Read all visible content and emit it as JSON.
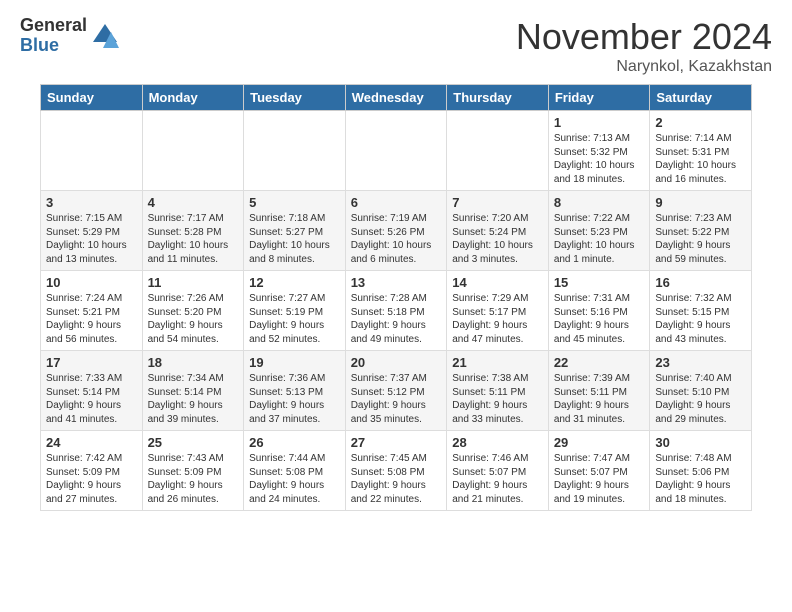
{
  "logo": {
    "general": "General",
    "blue": "Blue"
  },
  "title": "November 2024",
  "location": "Narynkol, Kazakhstan",
  "days_header": [
    "Sunday",
    "Monday",
    "Tuesday",
    "Wednesday",
    "Thursday",
    "Friday",
    "Saturday"
  ],
  "weeks": [
    [
      {
        "day": "",
        "content": ""
      },
      {
        "day": "",
        "content": ""
      },
      {
        "day": "",
        "content": ""
      },
      {
        "day": "",
        "content": ""
      },
      {
        "day": "",
        "content": ""
      },
      {
        "day": "1",
        "content": "Sunrise: 7:13 AM\nSunset: 5:32 PM\nDaylight: 10 hours and 18 minutes."
      },
      {
        "day": "2",
        "content": "Sunrise: 7:14 AM\nSunset: 5:31 PM\nDaylight: 10 hours and 16 minutes."
      }
    ],
    [
      {
        "day": "3",
        "content": "Sunrise: 7:15 AM\nSunset: 5:29 PM\nDaylight: 10 hours and 13 minutes."
      },
      {
        "day": "4",
        "content": "Sunrise: 7:17 AM\nSunset: 5:28 PM\nDaylight: 10 hours and 11 minutes."
      },
      {
        "day": "5",
        "content": "Sunrise: 7:18 AM\nSunset: 5:27 PM\nDaylight: 10 hours and 8 minutes."
      },
      {
        "day": "6",
        "content": "Sunrise: 7:19 AM\nSunset: 5:26 PM\nDaylight: 10 hours and 6 minutes."
      },
      {
        "day": "7",
        "content": "Sunrise: 7:20 AM\nSunset: 5:24 PM\nDaylight: 10 hours and 3 minutes."
      },
      {
        "day": "8",
        "content": "Sunrise: 7:22 AM\nSunset: 5:23 PM\nDaylight: 10 hours and 1 minute."
      },
      {
        "day": "9",
        "content": "Sunrise: 7:23 AM\nSunset: 5:22 PM\nDaylight: 9 hours and 59 minutes."
      }
    ],
    [
      {
        "day": "10",
        "content": "Sunrise: 7:24 AM\nSunset: 5:21 PM\nDaylight: 9 hours and 56 minutes."
      },
      {
        "day": "11",
        "content": "Sunrise: 7:26 AM\nSunset: 5:20 PM\nDaylight: 9 hours and 54 minutes."
      },
      {
        "day": "12",
        "content": "Sunrise: 7:27 AM\nSunset: 5:19 PM\nDaylight: 9 hours and 52 minutes."
      },
      {
        "day": "13",
        "content": "Sunrise: 7:28 AM\nSunset: 5:18 PM\nDaylight: 9 hours and 49 minutes."
      },
      {
        "day": "14",
        "content": "Sunrise: 7:29 AM\nSunset: 5:17 PM\nDaylight: 9 hours and 47 minutes."
      },
      {
        "day": "15",
        "content": "Sunrise: 7:31 AM\nSunset: 5:16 PM\nDaylight: 9 hours and 45 minutes."
      },
      {
        "day": "16",
        "content": "Sunrise: 7:32 AM\nSunset: 5:15 PM\nDaylight: 9 hours and 43 minutes."
      }
    ],
    [
      {
        "day": "17",
        "content": "Sunrise: 7:33 AM\nSunset: 5:14 PM\nDaylight: 9 hours and 41 minutes."
      },
      {
        "day": "18",
        "content": "Sunrise: 7:34 AM\nSunset: 5:14 PM\nDaylight: 9 hours and 39 minutes."
      },
      {
        "day": "19",
        "content": "Sunrise: 7:36 AM\nSunset: 5:13 PM\nDaylight: 9 hours and 37 minutes."
      },
      {
        "day": "20",
        "content": "Sunrise: 7:37 AM\nSunset: 5:12 PM\nDaylight: 9 hours and 35 minutes."
      },
      {
        "day": "21",
        "content": "Sunrise: 7:38 AM\nSunset: 5:11 PM\nDaylight: 9 hours and 33 minutes."
      },
      {
        "day": "22",
        "content": "Sunrise: 7:39 AM\nSunset: 5:11 PM\nDaylight: 9 hours and 31 minutes."
      },
      {
        "day": "23",
        "content": "Sunrise: 7:40 AM\nSunset: 5:10 PM\nDaylight: 9 hours and 29 minutes."
      }
    ],
    [
      {
        "day": "24",
        "content": "Sunrise: 7:42 AM\nSunset: 5:09 PM\nDaylight: 9 hours and 27 minutes."
      },
      {
        "day": "25",
        "content": "Sunrise: 7:43 AM\nSunset: 5:09 PM\nDaylight: 9 hours and 26 minutes."
      },
      {
        "day": "26",
        "content": "Sunrise: 7:44 AM\nSunset: 5:08 PM\nDaylight: 9 hours and 24 minutes."
      },
      {
        "day": "27",
        "content": "Sunrise: 7:45 AM\nSunset: 5:08 PM\nDaylight: 9 hours and 22 minutes."
      },
      {
        "day": "28",
        "content": "Sunrise: 7:46 AM\nSunset: 5:07 PM\nDaylight: 9 hours and 21 minutes."
      },
      {
        "day": "29",
        "content": "Sunrise: 7:47 AM\nSunset: 5:07 PM\nDaylight: 9 hours and 19 minutes."
      },
      {
        "day": "30",
        "content": "Sunrise: 7:48 AM\nSunset: 5:06 PM\nDaylight: 9 hours and 18 minutes."
      }
    ]
  ]
}
